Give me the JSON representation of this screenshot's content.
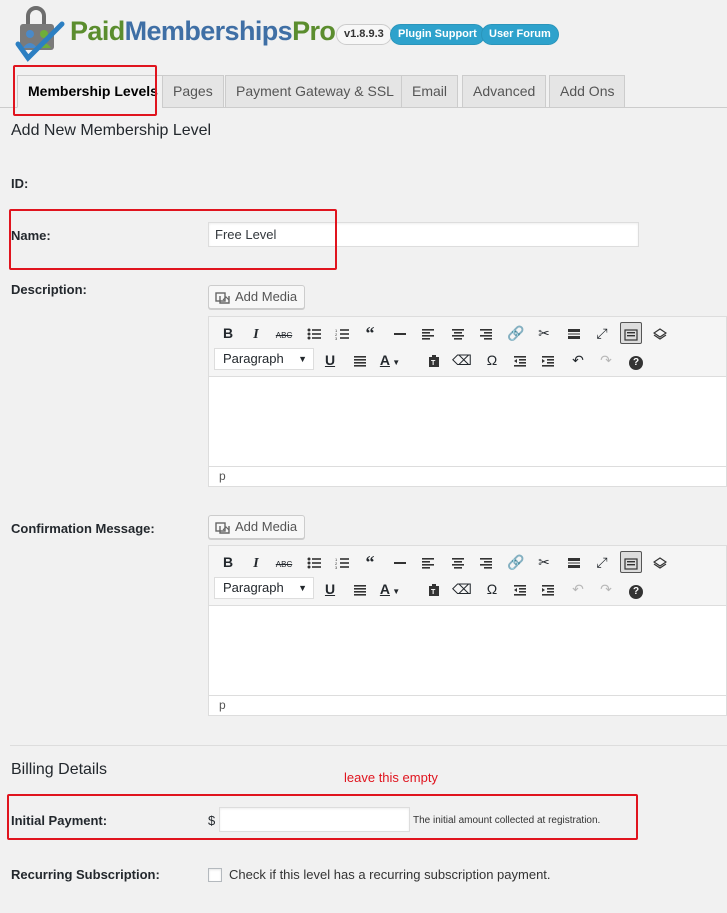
{
  "header": {
    "logo": {
      "paid": "Paid",
      "memberships": "Memberships",
      "pro": "Pro"
    },
    "version": "v1.8.9.3",
    "support_label": "Plugin Support",
    "forum_label": "User Forum"
  },
  "tabs": [
    {
      "label": "Membership Levels",
      "active": true
    },
    {
      "label": "Pages"
    },
    {
      "label": "Payment Gateway & SSL"
    },
    {
      "label": "Email"
    },
    {
      "label": "Advanced"
    },
    {
      "label": "Add Ons"
    }
  ],
  "form": {
    "title": "Add New Membership Level",
    "id_label": "ID:",
    "name_label": "Name:",
    "name_value": "Free Level",
    "description_label": "Description:",
    "confirmation_label": "Confirmation Message:",
    "add_media_label": "Add Media",
    "format_select": "Paragraph",
    "status_path": "p"
  },
  "toolbar_icons": [
    "bold-icon",
    "italic-icon",
    "strikethrough-icon",
    "bulleted-list-icon",
    "numbered-list-icon",
    "blockquote-icon",
    "horizontal-line-icon",
    "align-left-icon",
    "align-center-icon",
    "align-right-icon",
    "link-icon",
    "unlink-icon",
    "read-more-icon",
    "fullscreen-icon",
    "toolbar-toggle-icon",
    "layers-icon",
    "underline-icon",
    "justify-icon",
    "text-color-icon",
    "paste-text-icon",
    "clear-formatting-icon",
    "special-character-icon",
    "outdent-icon",
    "indent-icon",
    "undo-icon",
    "redo-icon",
    "help-icon"
  ],
  "billing": {
    "title": "Billing Details",
    "annotation": "leave this empty",
    "initial_payment_label": "Initial Payment:",
    "currency": "$",
    "initial_payment_value": "",
    "initial_payment_help": "The initial amount collected at registration.",
    "recurring_label": "Recurring Subscription:",
    "recurring_checkbox_label": "Check if this level has a recurring subscription payment."
  },
  "colors": {
    "annotation_red": "#e0141e",
    "button_blue": "#2ea2cc",
    "logo_green": "#5b8d2e",
    "logo_blue": "#3f6fa5"
  }
}
